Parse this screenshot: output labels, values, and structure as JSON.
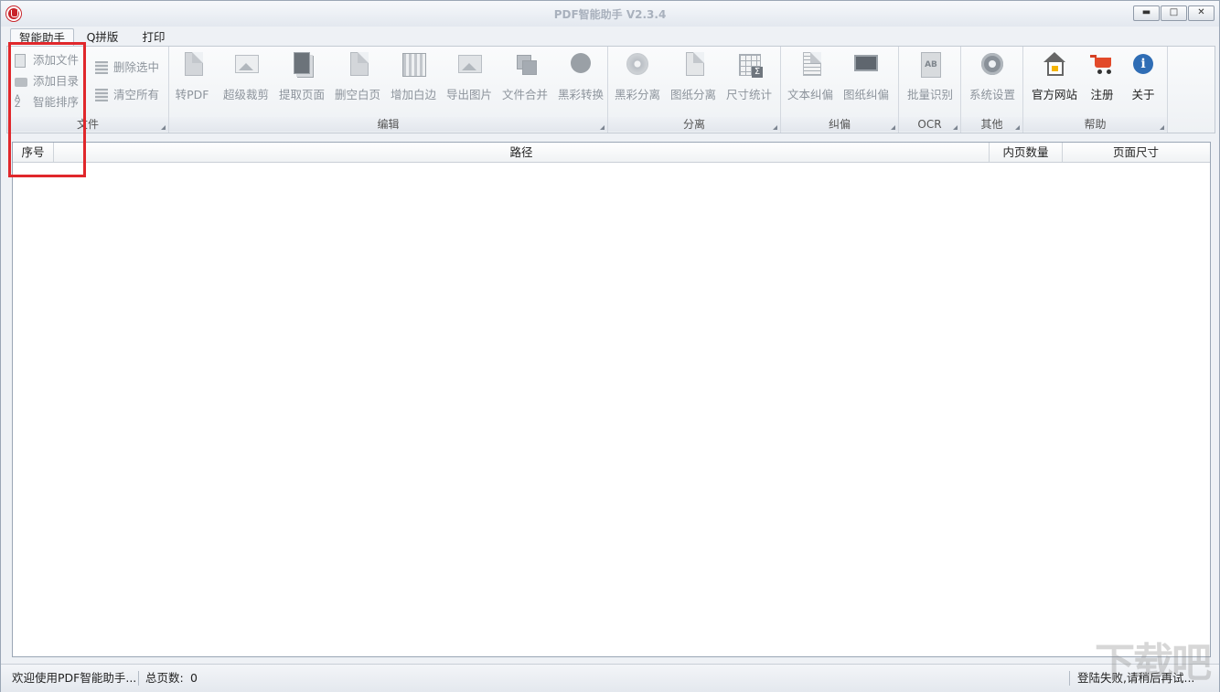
{
  "window": {
    "title": "PDF智能助手 V2.3.4",
    "controls": {
      "minimize": "▬",
      "maximize": "□",
      "close": "✕"
    }
  },
  "tabs": [
    {
      "label": "智能助手",
      "active": true
    },
    {
      "label": "Q拼版",
      "active": false
    },
    {
      "label": "打印",
      "active": false
    }
  ],
  "ribbon": {
    "file": {
      "label": "文件",
      "add_file": "添加文件",
      "add_dir": "添加目录",
      "smart_sort": "智能排序",
      "delete_selected": "删除选中",
      "clear_all": "清空所有"
    },
    "edit": {
      "label": "编辑",
      "buttons": [
        "转PDF",
        "超级裁剪",
        "提取页面",
        "删空白页",
        "增加白边",
        "导出图片",
        "文件合并",
        "黑彩转换"
      ]
    },
    "separate": {
      "label": "分离",
      "buttons": [
        "黑彩分离",
        "图纸分离",
        "尺寸统计"
      ]
    },
    "deskew": {
      "label": "纠偏",
      "buttons": [
        "文本纠偏",
        "图纸纠偏"
      ]
    },
    "ocr": {
      "label": "OCR",
      "buttons": [
        "批量识别"
      ]
    },
    "other": {
      "label": "其他",
      "buttons": [
        "系统设置"
      ]
    },
    "help": {
      "label": "帮助",
      "buttons": [
        "官方网站",
        "注册",
        "关于"
      ]
    }
  },
  "icons": {
    "ocr_ab": "AB",
    "about_i": "i",
    "sigma": "Σ"
  },
  "table": {
    "columns": [
      "序号",
      "路径",
      "内页数量",
      "页面尺寸"
    ],
    "rows": []
  },
  "status": {
    "welcome": "欢迎使用PDF智能助手...",
    "total_pages_label": "总页数:",
    "total_pages": "0",
    "login_msg": "登陆失败,请稍后再试..."
  },
  "watermark": "下载吧",
  "colors": {
    "highlight": "#e0272b",
    "accent_blue": "#2f6db5",
    "cart_red": "#e24a2a"
  }
}
